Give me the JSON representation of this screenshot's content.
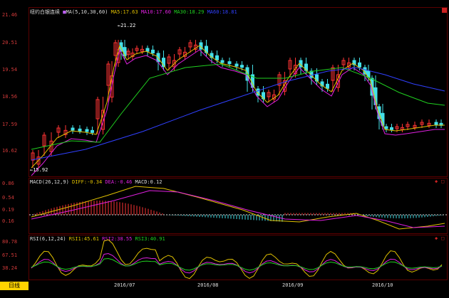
{
  "main_header": {
    "title": "纽约白银连续",
    "ma_label": "MA(5,10,30,60)",
    "ma5": "MA5:17.63",
    "ma10": "MA10:17.60",
    "ma30": "MA30:18.29",
    "ma60": "MA60:18.81"
  },
  "price_axis": [
    "21.46",
    "20.51",
    "19.54",
    "18.56",
    "17.59",
    "16.62"
  ],
  "annotations": {
    "high": "21.22",
    "low": "15.92"
  },
  "macd_header": {
    "label": "MACD(26,12,9)",
    "diff": "DIFF:-0.34",
    "dea": "DEA:-0.46",
    "macd": "MACD:0.12"
  },
  "macd_axis": [
    "0.86",
    "0.54",
    "0.19",
    "0.16"
  ],
  "rsi_header": {
    "label": "RSI(6,12,24)",
    "rsi1": "RSI1:45.61",
    "rsi2": "RSI2:38.55",
    "rsi3": "RSI3:40.91"
  },
  "rsi_axis": [
    "80.78",
    "67.51",
    "38.24"
  ],
  "x_axis": [
    "2016/07",
    "2016/08",
    "2016/09",
    "2016/10"
  ],
  "period": "日线",
  "colors": {
    "up": "#ff3333",
    "down": "#44e0e8",
    "ma5": "#f0f0f0",
    "ma10": "#e0c000",
    "ma30": "#e020e0",
    "ma60": "#20d020",
    "ma_long": "#3040ff",
    "frame": "#5a0000"
  },
  "icons": [
    "close-icon",
    "settings-icon",
    "marker-icon"
  ]
}
